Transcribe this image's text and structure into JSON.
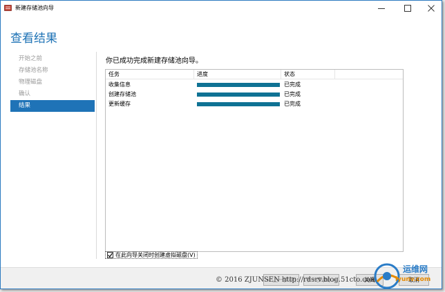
{
  "window": {
    "title": "新建存储池向导",
    "controls": {
      "minimize": "minimize",
      "maximize": "maximize",
      "close": "close"
    }
  },
  "header": {
    "title": "查看结果"
  },
  "nav": {
    "items": [
      {
        "label": "开始之前",
        "active": false
      },
      {
        "label": "存储池名称",
        "active": false
      },
      {
        "label": "物理磁盘",
        "active": false
      },
      {
        "label": "确认",
        "active": false
      },
      {
        "label": "结果",
        "active": true
      }
    ]
  },
  "content": {
    "heading": "你已成功完成新建存储池向导。",
    "columns": [
      "任务",
      "进度",
      "状态"
    ],
    "rows": [
      {
        "task": "收集信息",
        "progress": 100,
        "status": "已完成"
      },
      {
        "task": "创建存储池",
        "progress": 100,
        "status": "已完成"
      },
      {
        "task": "更新缓存",
        "progress": 100,
        "status": "已完成"
      }
    ],
    "checkbox": {
      "label": "在此向导关闭时创建虚拟磁盘(V)",
      "checked": true
    }
  },
  "footer": {
    "prev": "< 上一步(P)",
    "next": "下一步(N) >",
    "close": "关闭",
    "cancel": "取消"
  },
  "watermark": "© 2016 ZJUNSEN http://rdsrv.blog.51cto.com",
  "logo": {
    "main": "运维网",
    "sub": "iyunv.com"
  },
  "colors": {
    "accent": "#1f73b7",
    "progress": "#0f7294",
    "title": "#1d72b5"
  }
}
